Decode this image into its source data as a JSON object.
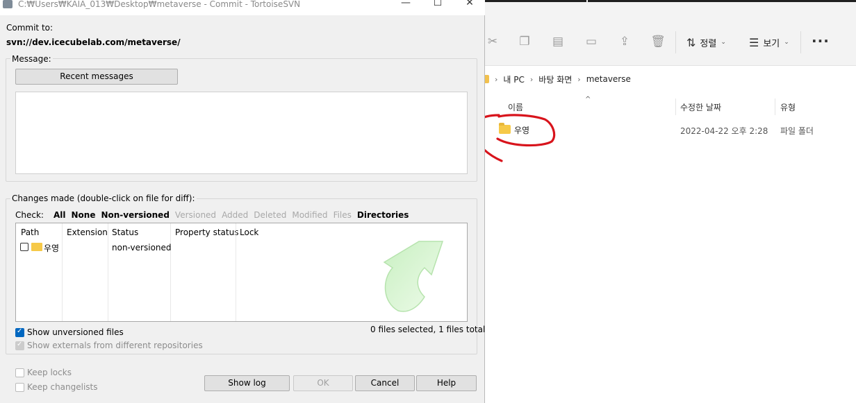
{
  "dialog": {
    "title": "C:₩Users₩KAIA_013₩Desktop₩metaverse - Commit - TortoiseSVN",
    "window_buttons": {
      "minimize": "—",
      "maximize": "☐",
      "close": "✕"
    },
    "commit_to_label": "Commit to:",
    "commit_url": "svn://dev.icecubelab.com/metaverse/",
    "message_label": "Message:",
    "recent_messages_button": "Recent messages",
    "message_text": "",
    "changes_label": "Changes made (double-click on file for diff):",
    "check": {
      "label": "Check:",
      "enabled": [
        "All",
        "None",
        "Non-versioned"
      ],
      "disabled": [
        "Versioned",
        "Added",
        "Deleted",
        "Modified",
        "Files"
      ],
      "last": "Directories"
    },
    "columns": [
      "Path",
      "Extension",
      "Status",
      "Property status",
      "Lock"
    ],
    "files": [
      {
        "path": "우영",
        "extension": "",
        "status": "non-versioned",
        "property_status": "",
        "lock": "",
        "checked": false
      }
    ],
    "show_unversioned": {
      "label": "Show unversioned files",
      "checked": true
    },
    "show_externals": {
      "label": "Show externals from different repositories",
      "checked": true,
      "disabled": true
    },
    "selection_summary": "0 files selected, 1 files total",
    "keep_locks": {
      "label": "Keep locks",
      "checked": false
    },
    "keep_changelists": {
      "label": "Keep changelists",
      "checked": false
    },
    "buttons": {
      "show_log": "Show log",
      "ok": "OK",
      "cancel": "Cancel",
      "help": "Help"
    }
  },
  "explorer": {
    "toolbar": {
      "icons": [
        "cut-icon",
        "copy-icon",
        "paste-icon",
        "rename-icon",
        "share-icon",
        "delete-icon"
      ],
      "sort_label": "정렬",
      "view_label": "보기",
      "more": "···"
    },
    "breadcrumb": [
      "내 PC",
      "바탕 화면",
      "metaverse"
    ],
    "columns": {
      "name": "이름",
      "modified": "수정한 날짜",
      "type": "유형"
    },
    "rows": [
      {
        "name": "우영",
        "modified": "2022-04-22 오후 2:28",
        "type": "파일 폴더"
      }
    ],
    "annotation_color": "#d8141c"
  }
}
